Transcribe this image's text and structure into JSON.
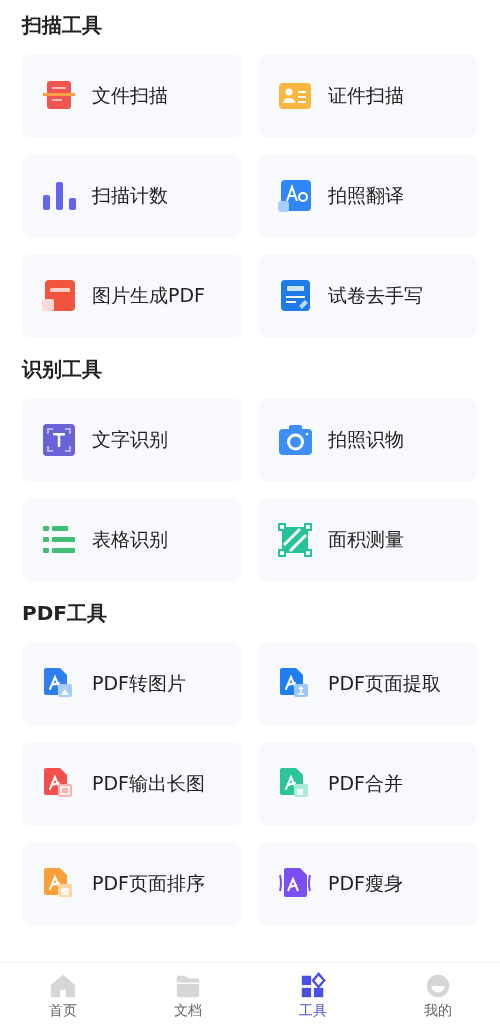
{
  "sections": [
    {
      "title": "扫描工具",
      "tools": [
        {
          "label": "文件扫描",
          "kind": "docscan"
        },
        {
          "label": "证件扫描",
          "kind": "idcard"
        },
        {
          "label": "扫描计数",
          "kind": "count"
        },
        {
          "label": "拍照翻译",
          "kind": "translate"
        },
        {
          "label": "图片生成PDF",
          "kind": "topdf"
        },
        {
          "label": "试卷去手写",
          "kind": "exam"
        }
      ]
    },
    {
      "title": "识别工具",
      "tools": [
        {
          "label": "文字识别",
          "kind": "ocr"
        },
        {
          "label": "拍照识物",
          "kind": "camera"
        },
        {
          "label": "表格识别",
          "kind": "table"
        },
        {
          "label": "面积测量",
          "kind": "area"
        }
      ]
    },
    {
      "title": "PDF工具",
      "tools": [
        {
          "label": "PDF转图片",
          "kind": "pdfimage"
        },
        {
          "label": "PDF页面提取",
          "kind": "pdfextract"
        },
        {
          "label": "PDF输出长图",
          "kind": "pdflong"
        },
        {
          "label": "PDF合并",
          "kind": "pdfmerge"
        },
        {
          "label": "PDF页面排序",
          "kind": "pdfsort"
        },
        {
          "label": "PDF瘦身",
          "kind": "pdfcompress"
        }
      ]
    }
  ],
  "tab_bar": [
    {
      "label": "首页",
      "kind": "home",
      "selected": false
    },
    {
      "label": "文档",
      "kind": "folder",
      "selected": false
    },
    {
      "label": "工具",
      "kind": "tools",
      "selected": true
    },
    {
      "label": "我的",
      "kind": "profile",
      "selected": false
    }
  ]
}
